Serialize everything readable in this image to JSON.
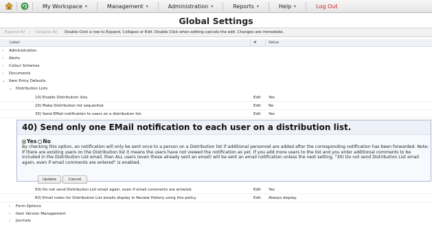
{
  "nav": {
    "items": [
      {
        "label": "My Workspace",
        "caret": "▾"
      },
      {
        "label": "Management",
        "caret": "▾"
      },
      {
        "label": "Administration",
        "caret": "▾"
      },
      {
        "label": "Reports",
        "caret": "▾"
      },
      {
        "label": "Help",
        "caret": "▾"
      }
    ],
    "logout": "Log Out"
  },
  "page": {
    "title": "Global Settings"
  },
  "toolbar": {
    "expand_all": "Expand All",
    "collapse_all": "Collapse All",
    "help": "Double Click a row to Expand, Collapse or Edit. Double Click when editing cancels the edit. Changes are immediate."
  },
  "grid": {
    "headers": {
      "label": "Label",
      "hash": "#",
      "value": "Value"
    },
    "top_sections": [
      {
        "chev": "›",
        "label": "Administration"
      },
      {
        "chev": "›",
        "label": "Alerts"
      },
      {
        "chev": "›",
        "label": "Colour Schemes"
      },
      {
        "chev": "›",
        "label": "Documents"
      },
      {
        "chev": "⌄",
        "label": "Item Entry Defaults"
      }
    ],
    "subsection": {
      "chev": "⌄",
      "label": "Distribution Lists"
    },
    "settings_before": [
      {
        "label": "10) Enable Distribution lists.",
        "edit": "Edit",
        "value": "Yes"
      },
      {
        "label": "20) Make Distribution list sequential.",
        "edit": "Edit",
        "value": "No"
      },
      {
        "label": "30) Send EMail notification to users on a distribution list.",
        "edit": "Edit",
        "value": "Yes"
      }
    ],
    "settings_after": [
      {
        "label": "50) Do not send Distribution List email again. even if email comments are entered.",
        "edit": "Edit",
        "value": "Yes"
      },
      {
        "label": "60) Email notes for Distribution List emails display in Review History using this policy.",
        "edit": "Edit",
        "value": "Always display."
      }
    ],
    "bottom_sections": [
      {
        "chev": "›",
        "label": "Form Options"
      },
      {
        "chev": "›",
        "label": "Item Version Management"
      },
      {
        "chev": "›",
        "label": "Journals"
      }
    ]
  },
  "editor": {
    "title": "40) Send only one EMail notification to each user on a distribution list.",
    "options": [
      {
        "label": "Yes",
        "selected": true
      },
      {
        "label": "No",
        "selected": false
      }
    ],
    "description": "By checking this option, an notification will only be sent once to a person on a Distribution list if additional personnel are added after the corresponding notification has been forwarded. Note: If there are existing users on the Distribution list it means the users have not viewed the notification as yet. If you add more users to the list and you enter additional comments to be included in the Distribution List email, then ALL users (even those already sent an email) will be sent an email notification unless the next setting, \"30) Do not send Distribution List email again, even if email comments are entered\" is enabled.",
    "update_label": "Update",
    "cancel_label": "Cancel"
  },
  "colors": {
    "logout": "#d11b1b",
    "panel_border": "#a9b9d3"
  }
}
